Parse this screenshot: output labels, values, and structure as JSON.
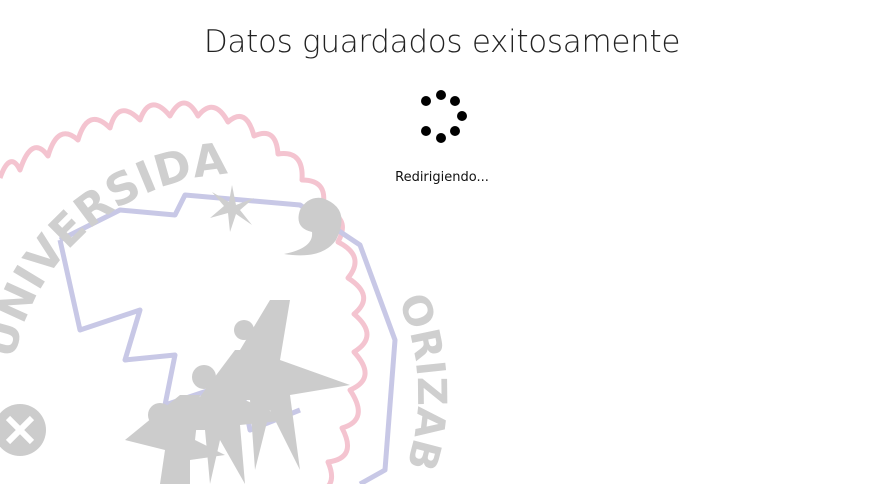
{
  "message": {
    "title": "Datos guardados exitosamente",
    "status": "Redirigiendo..."
  },
  "spinner": {
    "icon": "loading-spinner-icon"
  },
  "watermark": {
    "arc_text_left": "UNIVERSIDAD",
    "arc_text_right": "ORIZABA",
    "colors": {
      "border": "#f4c4d0",
      "text": "#cfcfcf",
      "shield": "#c8c8e6",
      "figures": "#cccccc"
    }
  }
}
